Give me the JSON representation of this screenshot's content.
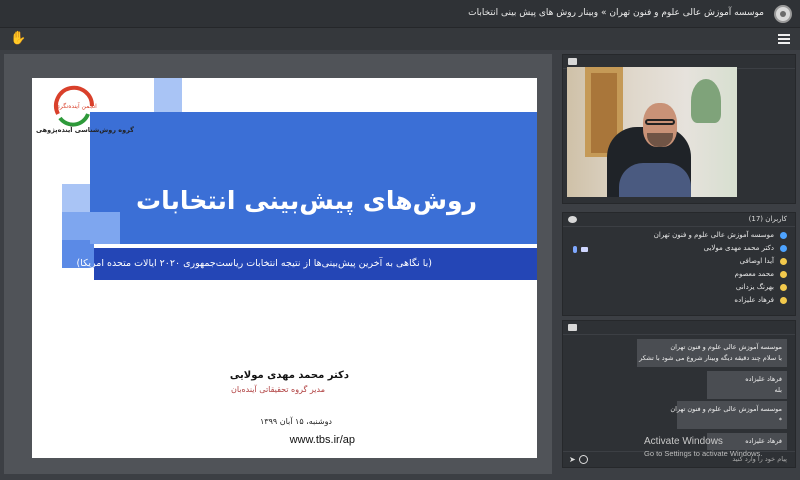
{
  "topbar": {
    "title": "موسسه آموزش عالی علوم و فنون تهران » وبینار روش های پیش بینی انتخابات"
  },
  "toolbar": {
    "hand_icon": "✋",
    "menu_icon": "hamburger-menu"
  },
  "slide": {
    "title": "روش‌های پیش‌بینی انتخابات",
    "subtitle": "(با نگاهی به آخرین پیش‌بینی‌ها از نتیجه انتخابات ریاست‌جمهوری ۲۰۲۰ ایالات متحده امریکا)",
    "logo_caption": "گروه روش‌شناسی آینده‌پژوهی",
    "author_name": "دکتر محمد مهدی مولایی",
    "author_role": "مدیر گروه تحقیقاتی آینده‌بان",
    "date": "دوشنبه، ۱۵ آبان ۱۳۹۹",
    "url": "www.tbs.ir/ap",
    "colors": {
      "band": "#3b6fd6",
      "subband": "#2446b6",
      "squares": [
        "#a9c4f5",
        "#7ea6ef",
        "#5b8ae6"
      ]
    }
  },
  "users": {
    "header": "کاربران (17)",
    "list": [
      {
        "name": "موسسه آموزش عالی علوم و فنون تهران",
        "color": "#4da3ff"
      },
      {
        "name": "دکتر محمد مهدی مولایی",
        "color": "#4da3ff",
        "mic": true,
        "cam": true
      },
      {
        "name": "آیدا اوصافی",
        "color": "#f2c94c"
      },
      {
        "name": "محمد معصوم",
        "color": "#f2c94c"
      },
      {
        "name": "بهرنگ یزدانی",
        "color": "#f2c94c"
      },
      {
        "name": "فرهاد علیزاده",
        "color": "#f2c94c"
      }
    ]
  },
  "chat": {
    "messages": [
      {
        "sender": "موسسه آموزش عالی علوم و فنون تهران",
        "text": "با سلام چند دقیقه دیگه وبینار شروع می شود با تشکر"
      },
      {
        "sender": "فرهاد علیزاده",
        "text": "بله"
      },
      {
        "sender": "موسسه آموزش عالی علوم و فنون تهران",
        "text": "*"
      },
      {
        "sender": "فرهاد علیزاده",
        "text": ""
      }
    ],
    "input_placeholder": "پیام خود را وارد کنید"
  },
  "watermark": {
    "line1": "Activate Windows",
    "line2": "Go to Settings to activate Windows."
  }
}
